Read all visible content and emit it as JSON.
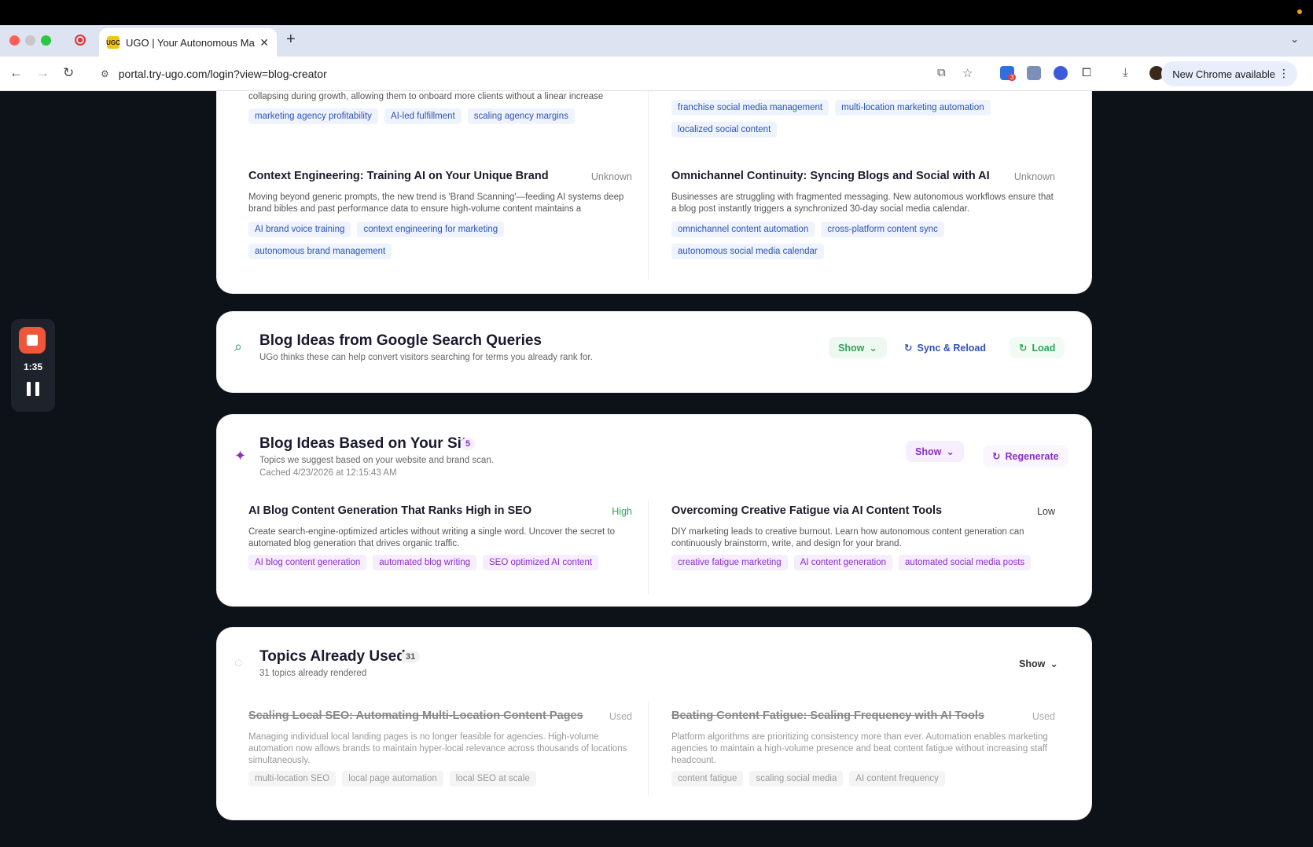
{
  "browser": {
    "tab_title": "UGO | Your Autonomous Mark",
    "favicon_text": "UGC",
    "url": "portal.try-ugo.com/login?view=blog-creator",
    "update_label": "New Chrome available",
    "extension_badge": "3"
  },
  "recorder": {
    "time": "1:35"
  },
  "top_section": {
    "cards": [
      {
        "title": "",
        "desc": "collapsing during growth, allowing them to onboard more clients without a linear increase",
        "tags": [
          "marketing agency profitability",
          "AI-led fulfillment",
          "scaling agency margins"
        ]
      },
      {
        "title": "",
        "desc": "",
        "tags": [
          "franchise social media management",
          "multi-location marketing automation",
          "localized social content"
        ]
      },
      {
        "title": "Context Engineering: Training AI on Your Unique Brand",
        "volume": "Unknown",
        "desc": "Moving beyond generic prompts, the new trend is 'Brand Scanning'—feeding AI systems deep brand bibles and past performance data to ensure high-volume content maintains a",
        "tags": [
          "AI brand voice training",
          "context engineering for marketing",
          "autonomous brand management"
        ]
      },
      {
        "title": "Omnichannel Continuity: Syncing Blogs and Social with AI",
        "volume": "Unknown",
        "desc": "Businesses are struggling with fragmented messaging. New autonomous workflows ensure that a blog post instantly triggers a synchronized 30-day social media calendar.",
        "tags": [
          "omnichannel content automation",
          "cross-platform content sync",
          "autonomous social media calendar"
        ]
      }
    ]
  },
  "google_section": {
    "title": "Blog Ideas from Google Search Queries",
    "subtitle": "UGo thinks these can help convert visitors searching for terms you already rank for.",
    "show_label": "Show",
    "sync_label": "Sync & Reload",
    "load_label": "Load"
  },
  "site_section": {
    "title": "Blog Ideas Based on Your Site",
    "count": "5",
    "subtitle": "Topics we suggest based on your website and brand scan.",
    "cached": "Cached 4/23/2026 at 12:15:43 AM",
    "show_label": "Show",
    "regenerate_label": "Regenerate",
    "cards": [
      {
        "title": "AI Blog Content Generation That Ranks High in SEO",
        "volume": "High",
        "desc": "Create search-engine-optimized articles without writing a single word. Uncover the secret to automated blog generation that drives organic traffic.",
        "tags": [
          "AI blog content generation",
          "automated blog writing",
          "SEO optimized AI content"
        ]
      },
      {
        "title": "Overcoming Creative Fatigue via AI Content Tools",
        "volume": "Low",
        "desc": "DIY marketing leads to creative burnout. Learn how autonomous content generation can continuously brainstorm, write, and design for your brand.",
        "tags": [
          "creative fatigue marketing",
          "AI content generation",
          "automated social media posts"
        ]
      }
    ]
  },
  "used_section": {
    "title": "Topics Already Used",
    "count": "31",
    "subtitle": "31 topics already rendered",
    "show_label": "Show",
    "cards": [
      {
        "title": "Scaling Local SEO: Automating Multi-Location Content Pages",
        "volume": "Used",
        "desc": "Managing individual local landing pages is no longer feasible for agencies. High-volume automation now allows brands to maintain hyper-local relevance across thousands of locations simultaneously.",
        "tags": [
          "multi-location SEO",
          "local page automation",
          "local SEO at scale"
        ]
      },
      {
        "title": "Beating Content Fatigue: Scaling Frequency with AI Tools",
        "volume": "Used",
        "desc": "Platform algorithms are prioritizing consistency more than ever. Automation enables marketing agencies to maintain a high-volume presence and beat content fatigue without increasing staff headcount.",
        "tags": [
          "content fatigue",
          "scaling social media",
          "AI content frequency"
        ]
      }
    ]
  },
  "colors": {
    "green": "#2fa35a",
    "blue": "#2e52b8",
    "purple": "#8a2ec4",
    "rec": "#f0563a"
  }
}
